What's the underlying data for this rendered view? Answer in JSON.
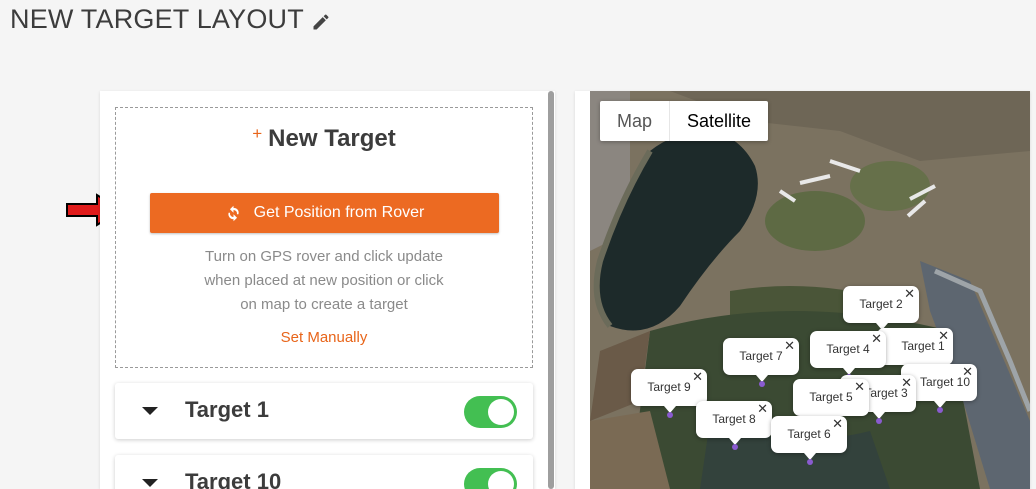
{
  "page": {
    "title": "NEW TARGET LAYOUT"
  },
  "new_target": {
    "plus": "+",
    "title": "New Target",
    "rover_button_label": "Get Position from Rover",
    "help_lines": [
      "Turn on GPS rover and click update",
      "when placed at new position or click",
      "on map to create a target"
    ],
    "set_manually_label": "Set Manually"
  },
  "targets": [
    {
      "name": "Target 1",
      "enabled": true
    },
    {
      "name": "Target 10",
      "enabled": true
    }
  ],
  "map": {
    "tabs": {
      "map": "Map",
      "satellite": "Satellite"
    },
    "active_tab": "Satellite",
    "marker_close_glyph": "✕",
    "markers": [
      {
        "label": "Target 2"
      },
      {
        "label": "Target 1"
      },
      {
        "label": "Target 4"
      },
      {
        "label": "Target 7"
      },
      {
        "label": "Target 10"
      },
      {
        "label": "Target 3"
      },
      {
        "label": "Target 9"
      },
      {
        "label": "Target 5"
      },
      {
        "label": "Target 8"
      },
      {
        "label": "Target 6"
      }
    ]
  },
  "colors": {
    "accent": "#ec6a22",
    "toggle_on": "#43bf52",
    "marker_dot": "#8a5bd0",
    "arrow": "#e01b1b"
  },
  "icons": [
    "pencil-icon",
    "refresh-icon",
    "red-arrow-icon",
    "caret-down-icon",
    "close-icon"
  ]
}
